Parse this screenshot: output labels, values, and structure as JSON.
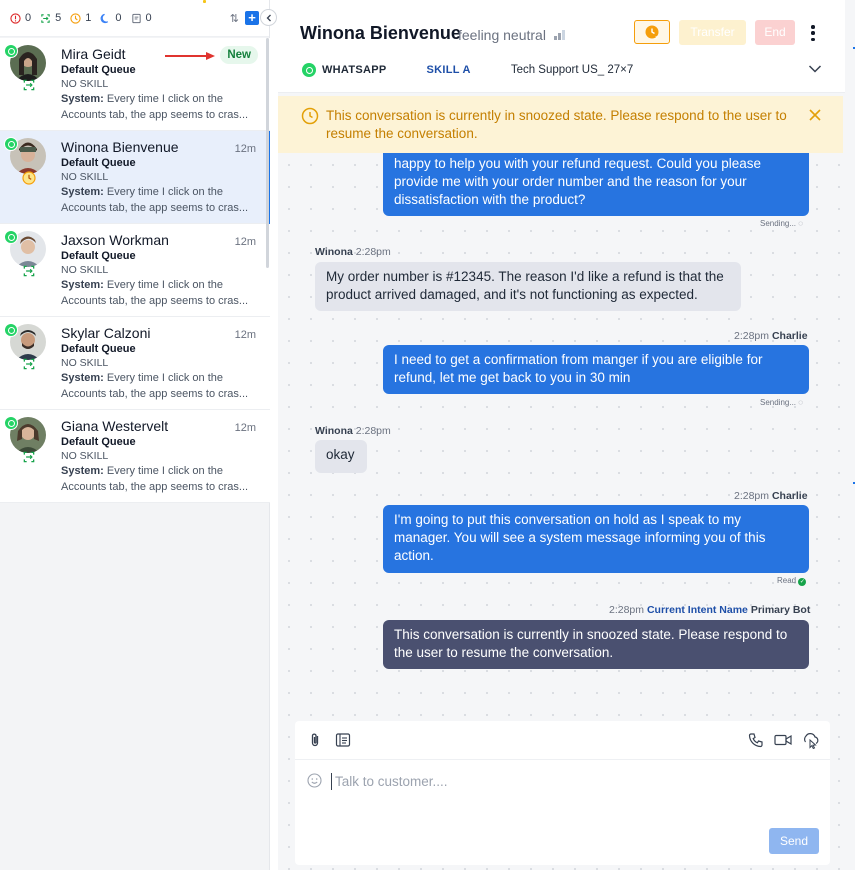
{
  "counters": [
    {
      "icon": "alert-circle-icon",
      "value": "0",
      "color": "#dc2626"
    },
    {
      "icon": "assigned-icon",
      "value": "5",
      "color": "#16a34a"
    },
    {
      "icon": "snooze-clock-icon",
      "value": "1",
      "color": "#f59e0b"
    },
    {
      "icon": "moon-icon",
      "value": "0",
      "color": "#3b82f6"
    },
    {
      "icon": "note-icon",
      "value": "0",
      "color": "#6b7280"
    }
  ],
  "conversations": [
    {
      "name": "Mira Geidt",
      "badge": "New",
      "time": "",
      "queue": "Default Queue",
      "skill": "NO SKILL",
      "msg_prefix": "System:",
      "msg": "Every time I click on the Accounts tab, the app seems to cras..."
    },
    {
      "name": "Winona Bienvenue",
      "badge": "",
      "time": "12m",
      "queue": "Default Queue",
      "skill": "NO SKILL",
      "msg_prefix": "System:",
      "msg": "Every time I click on the Accounts tab, the app seems to cras..."
    },
    {
      "name": "Jaxson Workman",
      "badge": "",
      "time": "12m",
      "queue": "Default Queue",
      "skill": "NO SKILL",
      "msg_prefix": "System:",
      "msg": "Every time I click on the Accounts tab, the app seems to cras..."
    },
    {
      "name": "Skylar Calzoni",
      "badge": "",
      "time": "12m",
      "queue": "Default Queue",
      "skill": "NO SKILL",
      "msg_prefix": "System:",
      "msg": "Every time I click on the Accounts tab, the app seems to cras..."
    },
    {
      "name": "Giana Westervelt",
      "badge": "",
      "time": "12m",
      "queue": "Default Queue",
      "skill": "NO SKILL",
      "msg_prefix": "System:",
      "msg": "Every time I click on the Accounts tab, the app seems to cras..."
    }
  ],
  "header": {
    "name": "Winona Bienvenue",
    "sentiment": "feeling neutral",
    "transfer": "Transfer",
    "end": "End",
    "channel": "WHATSAPP",
    "skill": "SKILL A",
    "queue": "Tech Support US_ 27×7"
  },
  "banner": {
    "text": "This conversation is currently in snoozed state. Please respond to the user to resume the conversation."
  },
  "messages": [
    {
      "type": "agent",
      "text": "happy to help you with your refund request. Could you please provide me with your order number and the reason for your dissatisfaction with the product?",
      "status": "Sending..."
    },
    {
      "type": "customer",
      "author": "Winona",
      "time": "2:28pm",
      "text": "My order number is #12345. The reason I'd like a refund is that the product arrived damaged, and it's not functioning as expected."
    },
    {
      "type": "agent",
      "author": "Charlie",
      "time": "2:28pm",
      "text": "I need to get a confirmation from manger if you are eligible for refund, let me get back to you in 30 min",
      "status": "Sending..."
    },
    {
      "type": "customer",
      "author": "Winona",
      "time": "2:28pm",
      "text": "okay"
    },
    {
      "type": "agent",
      "author": "Charlie",
      "time": "2:28pm",
      "text": "I'm going to put this conversation on hold as I speak to my manager. You will see a system message informing you of this action.",
      "status": "Read"
    },
    {
      "type": "bot",
      "author": "Primary Bot",
      "intent": "Current Intent Name",
      "time": "2:28pm",
      "text": "This conversation is currently in snoozed state. Please respond to the user to resume the conversation."
    }
  ],
  "composer": {
    "placeholder": "Talk to customer....",
    "send": "Send"
  }
}
